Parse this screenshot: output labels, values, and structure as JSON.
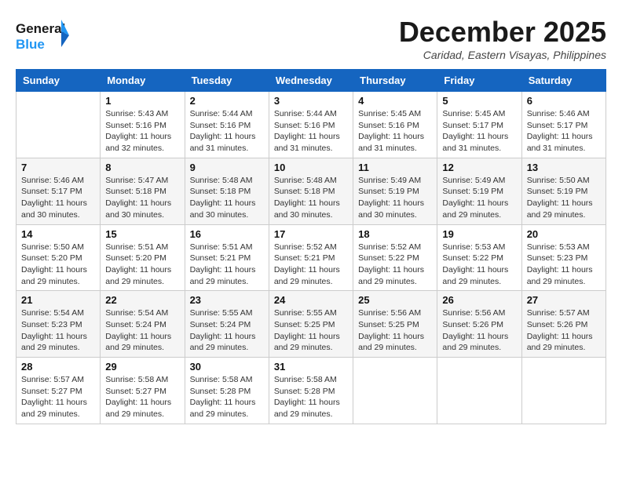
{
  "header": {
    "logo_line1": "General",
    "logo_line2": "Blue",
    "month": "December 2025",
    "location": "Caridad, Eastern Visayas, Philippines"
  },
  "weekdays": [
    "Sunday",
    "Monday",
    "Tuesday",
    "Wednesday",
    "Thursday",
    "Friday",
    "Saturday"
  ],
  "weeks": [
    [
      {
        "day": "",
        "sunrise": "",
        "sunset": "",
        "daylight": ""
      },
      {
        "day": "1",
        "sunrise": "Sunrise: 5:43 AM",
        "sunset": "Sunset: 5:16 PM",
        "daylight": "Daylight: 11 hours and 32 minutes."
      },
      {
        "day": "2",
        "sunrise": "Sunrise: 5:44 AM",
        "sunset": "Sunset: 5:16 PM",
        "daylight": "Daylight: 11 hours and 31 minutes."
      },
      {
        "day": "3",
        "sunrise": "Sunrise: 5:44 AM",
        "sunset": "Sunset: 5:16 PM",
        "daylight": "Daylight: 11 hours and 31 minutes."
      },
      {
        "day": "4",
        "sunrise": "Sunrise: 5:45 AM",
        "sunset": "Sunset: 5:16 PM",
        "daylight": "Daylight: 11 hours and 31 minutes."
      },
      {
        "day": "5",
        "sunrise": "Sunrise: 5:45 AM",
        "sunset": "Sunset: 5:17 PM",
        "daylight": "Daylight: 11 hours and 31 minutes."
      },
      {
        "day": "6",
        "sunrise": "Sunrise: 5:46 AM",
        "sunset": "Sunset: 5:17 PM",
        "daylight": "Daylight: 11 hours and 31 minutes."
      }
    ],
    [
      {
        "day": "7",
        "sunrise": "Sunrise: 5:46 AM",
        "sunset": "Sunset: 5:17 PM",
        "daylight": "Daylight: 11 hours and 30 minutes."
      },
      {
        "day": "8",
        "sunrise": "Sunrise: 5:47 AM",
        "sunset": "Sunset: 5:18 PM",
        "daylight": "Daylight: 11 hours and 30 minutes."
      },
      {
        "day": "9",
        "sunrise": "Sunrise: 5:48 AM",
        "sunset": "Sunset: 5:18 PM",
        "daylight": "Daylight: 11 hours and 30 minutes."
      },
      {
        "day": "10",
        "sunrise": "Sunrise: 5:48 AM",
        "sunset": "Sunset: 5:18 PM",
        "daylight": "Daylight: 11 hours and 30 minutes."
      },
      {
        "day": "11",
        "sunrise": "Sunrise: 5:49 AM",
        "sunset": "Sunset: 5:19 PM",
        "daylight": "Daylight: 11 hours and 30 minutes."
      },
      {
        "day": "12",
        "sunrise": "Sunrise: 5:49 AM",
        "sunset": "Sunset: 5:19 PM",
        "daylight": "Daylight: 11 hours and 29 minutes."
      },
      {
        "day": "13",
        "sunrise": "Sunrise: 5:50 AM",
        "sunset": "Sunset: 5:19 PM",
        "daylight": "Daylight: 11 hours and 29 minutes."
      }
    ],
    [
      {
        "day": "14",
        "sunrise": "Sunrise: 5:50 AM",
        "sunset": "Sunset: 5:20 PM",
        "daylight": "Daylight: 11 hours and 29 minutes."
      },
      {
        "day": "15",
        "sunrise": "Sunrise: 5:51 AM",
        "sunset": "Sunset: 5:20 PM",
        "daylight": "Daylight: 11 hours and 29 minutes."
      },
      {
        "day": "16",
        "sunrise": "Sunrise: 5:51 AM",
        "sunset": "Sunset: 5:21 PM",
        "daylight": "Daylight: 11 hours and 29 minutes."
      },
      {
        "day": "17",
        "sunrise": "Sunrise: 5:52 AM",
        "sunset": "Sunset: 5:21 PM",
        "daylight": "Daylight: 11 hours and 29 minutes."
      },
      {
        "day": "18",
        "sunrise": "Sunrise: 5:52 AM",
        "sunset": "Sunset: 5:22 PM",
        "daylight": "Daylight: 11 hours and 29 minutes."
      },
      {
        "day": "19",
        "sunrise": "Sunrise: 5:53 AM",
        "sunset": "Sunset: 5:22 PM",
        "daylight": "Daylight: 11 hours and 29 minutes."
      },
      {
        "day": "20",
        "sunrise": "Sunrise: 5:53 AM",
        "sunset": "Sunset: 5:23 PM",
        "daylight": "Daylight: 11 hours and 29 minutes."
      }
    ],
    [
      {
        "day": "21",
        "sunrise": "Sunrise: 5:54 AM",
        "sunset": "Sunset: 5:23 PM",
        "daylight": "Daylight: 11 hours and 29 minutes."
      },
      {
        "day": "22",
        "sunrise": "Sunrise: 5:54 AM",
        "sunset": "Sunset: 5:24 PM",
        "daylight": "Daylight: 11 hours and 29 minutes."
      },
      {
        "day": "23",
        "sunrise": "Sunrise: 5:55 AM",
        "sunset": "Sunset: 5:24 PM",
        "daylight": "Daylight: 11 hours and 29 minutes."
      },
      {
        "day": "24",
        "sunrise": "Sunrise: 5:55 AM",
        "sunset": "Sunset: 5:25 PM",
        "daylight": "Daylight: 11 hours and 29 minutes."
      },
      {
        "day": "25",
        "sunrise": "Sunrise: 5:56 AM",
        "sunset": "Sunset: 5:25 PM",
        "daylight": "Daylight: 11 hours and 29 minutes."
      },
      {
        "day": "26",
        "sunrise": "Sunrise: 5:56 AM",
        "sunset": "Sunset: 5:26 PM",
        "daylight": "Daylight: 11 hours and 29 minutes."
      },
      {
        "day": "27",
        "sunrise": "Sunrise: 5:57 AM",
        "sunset": "Sunset: 5:26 PM",
        "daylight": "Daylight: 11 hours and 29 minutes."
      }
    ],
    [
      {
        "day": "28",
        "sunrise": "Sunrise: 5:57 AM",
        "sunset": "Sunset: 5:27 PM",
        "daylight": "Daylight: 11 hours and 29 minutes."
      },
      {
        "day": "29",
        "sunrise": "Sunrise: 5:58 AM",
        "sunset": "Sunset: 5:27 PM",
        "daylight": "Daylight: 11 hours and 29 minutes."
      },
      {
        "day": "30",
        "sunrise": "Sunrise: 5:58 AM",
        "sunset": "Sunset: 5:28 PM",
        "daylight": "Daylight: 11 hours and 29 minutes."
      },
      {
        "day": "31",
        "sunrise": "Sunrise: 5:58 AM",
        "sunset": "Sunset: 5:28 PM",
        "daylight": "Daylight: 11 hours and 29 minutes."
      },
      {
        "day": "",
        "sunrise": "",
        "sunset": "",
        "daylight": ""
      },
      {
        "day": "",
        "sunrise": "",
        "sunset": "",
        "daylight": ""
      },
      {
        "day": "",
        "sunrise": "",
        "sunset": "",
        "daylight": ""
      }
    ]
  ]
}
